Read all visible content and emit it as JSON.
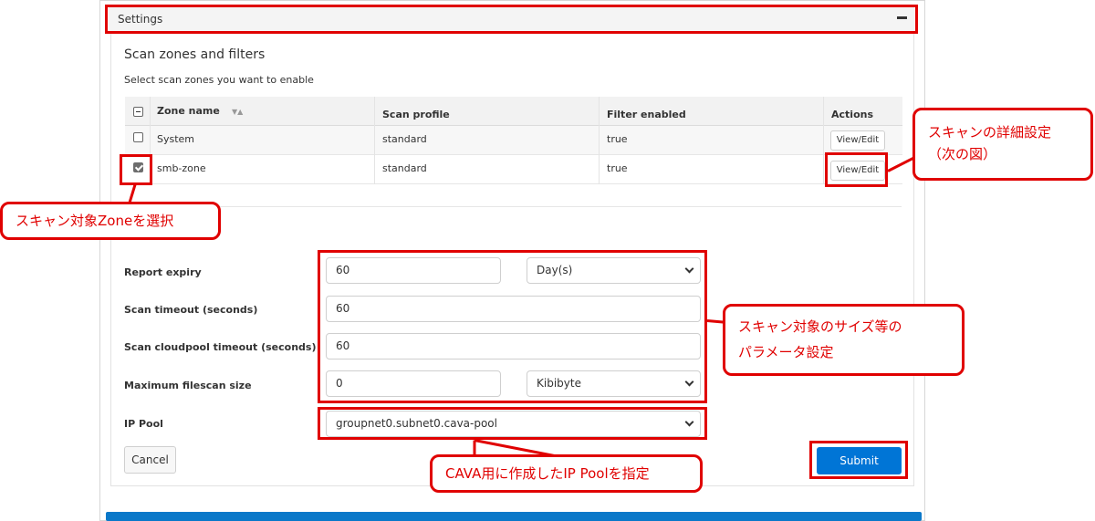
{
  "panel": {
    "title": "Settings"
  },
  "scan_zones": {
    "title": "Scan zones and filters",
    "subtitle": "Select scan zones you want to enable",
    "columns": [
      "Zone name",
      "Scan profile",
      "Filter enabled",
      "Actions"
    ],
    "rows": [
      {
        "zone": "System",
        "profile": "standard",
        "filter": "true",
        "action": "View/Edit",
        "checked": false
      },
      {
        "zone": "smb-zone",
        "profile": "standard",
        "filter": "true",
        "action": "View/Edit",
        "checked": true
      }
    ]
  },
  "form": {
    "report_expiry": {
      "label": "Report expiry",
      "value": "60",
      "unit": "Day(s)"
    },
    "scan_timeout": {
      "label": "Scan timeout (seconds)",
      "value": "60"
    },
    "cloudpool_timeout": {
      "label": "Scan cloudpool timeout (seconds)",
      "value": "60"
    },
    "max_filescan": {
      "label": "Maximum filescan size",
      "value": "0",
      "unit": "Kibibyte"
    },
    "ip_pool": {
      "label": "IP Pool",
      "value": "groupnet0.subnet0.cava-pool"
    }
  },
  "buttons": {
    "cancel": "Cancel",
    "submit": "Submit"
  },
  "callouts": {
    "detail_line1": "スキャンの詳細設定",
    "detail_line2": "（次の図）",
    "zone_select": "スキャン対象Zoneを選択",
    "params_line1": "スキャン対象のサイズ等の",
    "params_line2": "パラメータ設定",
    "ip_pool": "CAVA用に作成したIP Poolを指定"
  },
  "colors": {
    "accent": "#0075d6",
    "highlight": "#e00000"
  }
}
